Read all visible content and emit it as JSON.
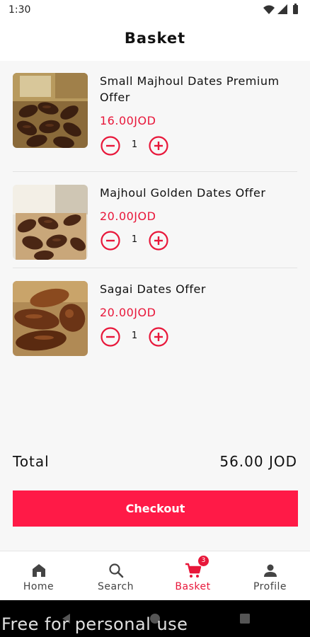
{
  "status": {
    "time": "1:30"
  },
  "header": {
    "title": "Basket"
  },
  "items": [
    {
      "name": "Small Majhoul Dates Premium Offer",
      "price": "16.00JOD",
      "qty": "1"
    },
    {
      "name": "Majhoul Golden Dates Offer",
      "price": "20.00JOD",
      "qty": "1"
    },
    {
      "name": "Sagai Dates Offer",
      "price": "20.00JOD",
      "qty": "1"
    }
  ],
  "total": {
    "label": "Total",
    "value": "56.00 JOD"
  },
  "checkout": {
    "label": "Checkout"
  },
  "nav": {
    "items": [
      {
        "label": "Home",
        "icon": "home-icon"
      },
      {
        "label": "Search",
        "icon": "search-icon"
      },
      {
        "label": "Basket",
        "icon": "cart-icon",
        "badge": "3",
        "active": true
      },
      {
        "label": "Profile",
        "icon": "person-icon"
      }
    ]
  },
  "watermark": "Free for personal use",
  "colors": {
    "accent": "#e8173a",
    "button": "#ff1a47"
  }
}
